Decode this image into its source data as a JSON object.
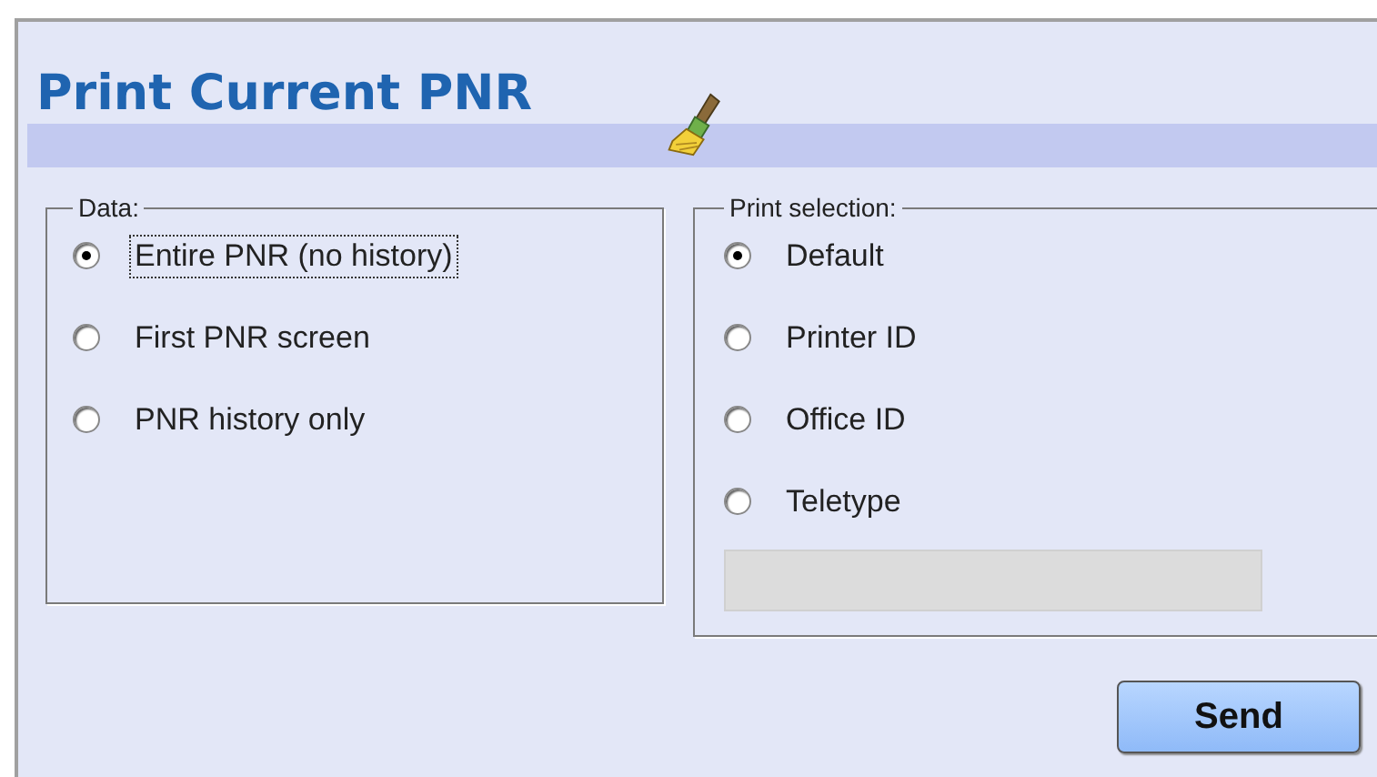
{
  "title": "Print Current PNR",
  "data_group": {
    "legend": "Data:",
    "options": [
      {
        "label": "Entire PNR (no history)",
        "selected": true,
        "focused": true
      },
      {
        "label": "First PNR screen",
        "selected": false,
        "focused": false
      },
      {
        "label": "PNR history only",
        "selected": false,
        "focused": false
      }
    ]
  },
  "print_selection": {
    "legend": "Print selection:",
    "options": [
      {
        "label": "Default",
        "selected": true
      },
      {
        "label": "Printer ID",
        "selected": false
      },
      {
        "label": "Office ID",
        "selected": false
      },
      {
        "label": "Teletype",
        "selected": false
      }
    ],
    "teletype_field": {
      "disabled": true
    }
  },
  "buttons": [
    "Send"
  ]
}
